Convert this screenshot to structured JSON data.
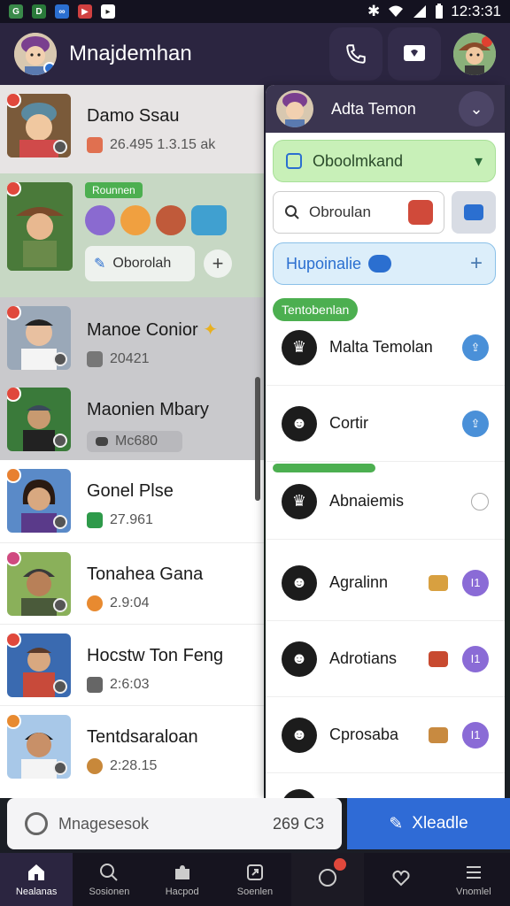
{
  "status_bar": {
    "time": "12:3:31"
  },
  "header": {
    "title": "Mnajdemhan"
  },
  "chats": [
    {
      "name": "Damo Ssau",
      "meta": "26.495  1.3.15 ak"
    },
    {
      "tag": "Rounnen",
      "chip": "Oborolah"
    },
    {
      "name": "Manoe Conior",
      "meta": "20421"
    },
    {
      "name": "Maonien Mbary",
      "meta": "Mc680"
    },
    {
      "name": "Gonel Plse",
      "meta": "27.961"
    },
    {
      "name": "Tonahea Gana",
      "meta": "2.9:04"
    },
    {
      "name": "Hocstw Ton Feng",
      "meta": "2:6:03"
    },
    {
      "name": "Tentdsaraloan",
      "meta": "2:28.15"
    }
  ],
  "panel": {
    "title": "Adta Temon",
    "dropdown": "Oboolmkand",
    "search_value": "Obroulan",
    "upload": "Hupoinalie",
    "section1": "Tentobenlan",
    "section2": "",
    "contacts": [
      {
        "name": "Malta Temolan"
      },
      {
        "name": "Cortir"
      },
      {
        "name": "Abnaiemis"
      },
      {
        "name": "Agralinn",
        "badge": "I1"
      },
      {
        "name": "Adrotians",
        "badge": "I1"
      },
      {
        "name": "Cprosaba",
        "badge": "I1"
      }
    ]
  },
  "bottom": {
    "search_label": "Mnagesesok",
    "search_value": "269 C3",
    "action_label": "Xleadle"
  },
  "nav": [
    {
      "label": "Nealanas"
    },
    {
      "label": "Sosionen"
    },
    {
      "label": "Hacpod"
    },
    {
      "label": "Soenlen"
    },
    {
      "label": ""
    },
    {
      "label": ""
    },
    {
      "label": "Vnomlel"
    }
  ],
  "colors": {
    "header": "#2b2540",
    "accent_blue": "#2f6bd6",
    "green": "#4caf50",
    "purple": "#8a6bd6"
  }
}
